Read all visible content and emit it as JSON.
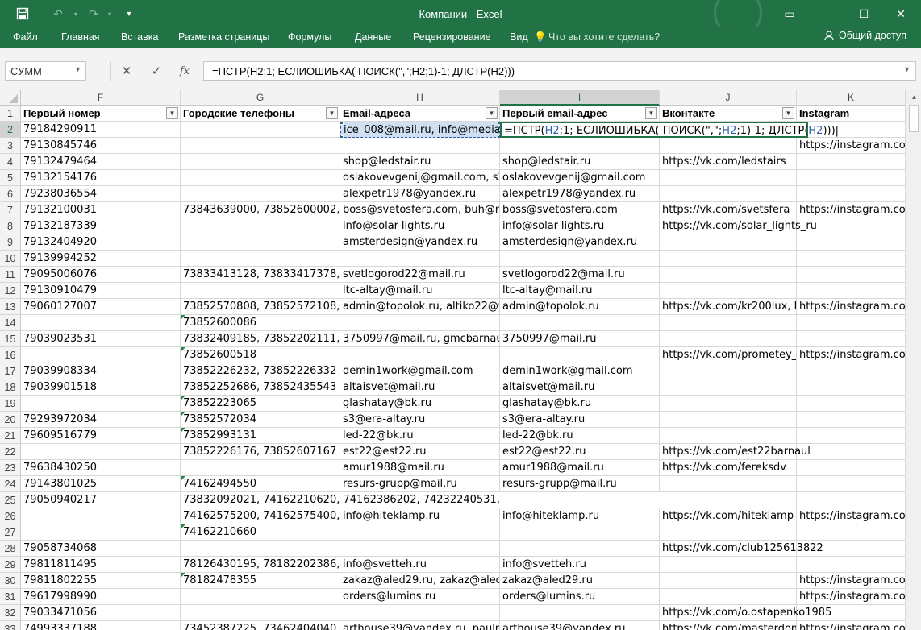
{
  "window": {
    "title": "Компании - Excel",
    "quick_access": {
      "save": "💾",
      "undo": "↶",
      "redo": "↷",
      "customize": "▾"
    },
    "controls": {
      "ribbon_options": "▭",
      "minimize": "—",
      "maximize": "☐",
      "close": "✕"
    }
  },
  "ribbon": {
    "tabs": [
      "Файл",
      "Главная",
      "Вставка",
      "Разметка страницы",
      "Формулы",
      "Данные",
      "Рецензирование",
      "Вид"
    ],
    "tell_me": "Что вы хотите сделать?",
    "tell_me_icon": "lightbulb-icon",
    "share": "Общий доступ",
    "share_icon": "person-icon"
  },
  "formula_bar": {
    "name_box": "СУММ",
    "cancel": "✕",
    "enter": "✓",
    "fx": "fx",
    "formula": "=ПСТР(H2;1; ЕСЛИОШИБКА( ПОИСК(\",\";H2;1)-1; ДЛСТР(H2)))"
  },
  "columns": [
    "F",
    "G",
    "H",
    "I",
    "J",
    "K"
  ],
  "headers": {
    "F": "Первый номер",
    "G": "Городские телефоны",
    "H": "Email-адреса",
    "I": "Первый email-адрес",
    "J": "Вконтакте",
    "K": "Instagram"
  },
  "active_cell_formula": {
    "a": "=ПСТР(",
    "b": "H2",
    "c": ";1; ЕСЛИОШИБКА( ПОИСК(\",\";",
    "d": "H2",
    "e": ";1)-1; ДЛСТР(",
    "f": "H2",
    "g": ")))"
  },
  "rows": [
    {
      "n": "2",
      "F": "79184290911",
      "G": "",
      "H": "ice_008@mail.ru, info@mediart",
      "I": "",
      "J": "",
      "K": ""
    },
    {
      "n": "3",
      "F": "79130845746",
      "G": "",
      "H": "",
      "I": "",
      "J": "",
      "K": "https://instagram.co"
    },
    {
      "n": "4",
      "F": "79132479464",
      "G": "",
      "H": "shop@ledstair.ru",
      "I": "shop@ledstair.ru",
      "J": "https://vk.com/ledstairs",
      "K": ""
    },
    {
      "n": "5",
      "F": "79132154176",
      "G": "",
      "H": "oslakovevgenij@gmail.com, s21",
      "I": "oslakovevgenij@gmail.com",
      "J": "",
      "K": ""
    },
    {
      "n": "6",
      "F": "79238036554",
      "G": "",
      "H": "alexpetr1978@yandex.ru",
      "I": "alexpetr1978@yandex.ru",
      "J": "",
      "K": ""
    },
    {
      "n": "7",
      "F": "79132100031",
      "G": "73843639000, 73852600002, 7385",
      "H": "boss@svetosfera.com, buh@ne",
      "I": "boss@svetosfera.com",
      "J": "https://vk.com/svetsfera",
      "K": "https://instagram.co"
    },
    {
      "n": "8",
      "F": "79132187339",
      "G": "",
      "H": "info@solar-lights.ru",
      "I": "info@solar-lights.ru",
      "J": "https://vk.com/solar_lights_ru",
      "K": ""
    },
    {
      "n": "9",
      "F": "79132404920",
      "G": "",
      "H": "amsterdesign@yandex.ru",
      "I": "amsterdesign@yandex.ru",
      "J": "",
      "K": ""
    },
    {
      "n": "10",
      "F": "79139994252",
      "G": "",
      "H": "",
      "I": "",
      "J": "",
      "K": ""
    },
    {
      "n": "11",
      "F": "79095006076",
      "G": "73833413128, 73833417378, 7383",
      "H": "svetlogorod22@mail.ru",
      "I": "svetlogorod22@mail.ru",
      "J": "",
      "K": ""
    },
    {
      "n": "12",
      "F": "79130910479",
      "G": "",
      "H": "ltc-altay@mail.ru",
      "I": "ltc-altay@mail.ru",
      "J": "",
      "K": ""
    },
    {
      "n": "13",
      "F": "79060127007",
      "G": "73852570808, 73852572108, 7495",
      "H": "admin@topolok.ru, altiko22@ya",
      "I": "admin@topolok.ru",
      "J": "https://vk.com/kr200lux, ht",
      "K": "https://instagram.co"
    },
    {
      "n": "14",
      "F": "",
      "G": "73852600086",
      "H": "",
      "I": "",
      "J": "",
      "K": "",
      "tri": true
    },
    {
      "n": "15",
      "F": "79039023531",
      "G": "73832409185, 73852202111, 7385",
      "H": "3750997@mail.ru, gmcbarnaul@",
      "I": "3750997@mail.ru",
      "J": "",
      "K": ""
    },
    {
      "n": "16",
      "F": "",
      "G": "73852600518",
      "H": "",
      "I": "",
      "J": "https://vk.com/prometey_",
      "K": "https://instagram.co",
      "tri": true
    },
    {
      "n": "17",
      "F": "79039908334",
      "G": "73852226232, 73852226332",
      "H": "demin1work@gmail.com",
      "I": "demin1work@gmail.com",
      "J": "",
      "K": ""
    },
    {
      "n": "18",
      "F": "79039901518",
      "G": "73852252686, 73852435543",
      "H": "altaisvet@mail.ru",
      "I": "altaisvet@mail.ru",
      "J": "",
      "K": ""
    },
    {
      "n": "19",
      "F": "",
      "G": "73852223065",
      "H": "glashatay@bk.ru",
      "I": "glashatay@bk.ru",
      "J": "",
      "K": "",
      "tri": true
    },
    {
      "n": "20",
      "F": "79293972034",
      "G": "73852572034",
      "H": "s3@era-altay.ru",
      "I": "s3@era-altay.ru",
      "J": "",
      "K": "",
      "tri": true
    },
    {
      "n": "21",
      "F": "79609516779",
      "G": "73852993131",
      "H": "led-22@bk.ru",
      "I": "led-22@bk.ru",
      "J": "",
      "K": "",
      "tri": true
    },
    {
      "n": "22",
      "F": "",
      "G": "73852226176, 73852607167",
      "H": "est22@est22.ru",
      "I": "est22@est22.ru",
      "J": "https://vk.com/est22barnaul",
      "K": ""
    },
    {
      "n": "23",
      "F": "79638430250",
      "G": "",
      "H": "amur1988@mail.ru",
      "I": "amur1988@mail.ru",
      "J": "https://vk.com/fereksdv",
      "K": ""
    },
    {
      "n": "24",
      "F": "79143801025",
      "G": "74162494550",
      "H": "resurs-grupp@mail.ru",
      "I": "resurs-grupp@mail.ru",
      "J": "",
      "K": "",
      "tri": true
    },
    {
      "n": "25",
      "F": "79050940217",
      "G": "73832092021, 74162210620, 74162386202, 74232240531, 74234320",
      "H": "",
      "I": "",
      "J": "",
      "K": "",
      "overflowG": true
    },
    {
      "n": "26",
      "F": "",
      "G": "74162575200, 74162575400, 7495",
      "H": "info@hiteklamp.ru",
      "I": "info@hiteklamp.ru",
      "J": "https://vk.com/hiteklamp",
      "K": "https://instagram.co"
    },
    {
      "n": "27",
      "F": "",
      "G": "74162210660",
      "H": "",
      "I": "",
      "J": "",
      "K": "",
      "tri": true
    },
    {
      "n": "28",
      "F": "79058734068",
      "G": "",
      "H": "",
      "I": "",
      "J": "https://vk.com/club125613822",
      "K": ""
    },
    {
      "n": "29",
      "F": "79811811495",
      "G": "78126430195, 78182202386, 7818",
      "H": "info@svetteh.ru",
      "I": "info@svetteh.ru",
      "J": "",
      "K": ""
    },
    {
      "n": "30",
      "F": "79811802255",
      "G": "78182478355",
      "H": "zakaz@aled29.ru, zakaz@aledsp",
      "I": "zakaz@aled29.ru",
      "J": "",
      "K": "https://instagram.co",
      "tri": true
    },
    {
      "n": "31",
      "F": "79617998990",
      "G": "",
      "H": "orders@lumins.ru",
      "I": "orders@lumins.ru",
      "J": "",
      "K": "https://instagram.co"
    },
    {
      "n": "32",
      "F": "79033471056",
      "G": "",
      "H": "",
      "I": "",
      "J": "https://vk.com/o.ostapenko1985",
      "K": ""
    },
    {
      "n": "33",
      "F": "74993337188",
      "G": "73452387225, 73462404040, 7471",
      "H": "arthouse39@yandex.ru, paulma",
      "I": "arthouse39@yandex.ru",
      "J": "https://vk.com/masterdom",
      "K": "https://instagram.co"
    }
  ]
}
